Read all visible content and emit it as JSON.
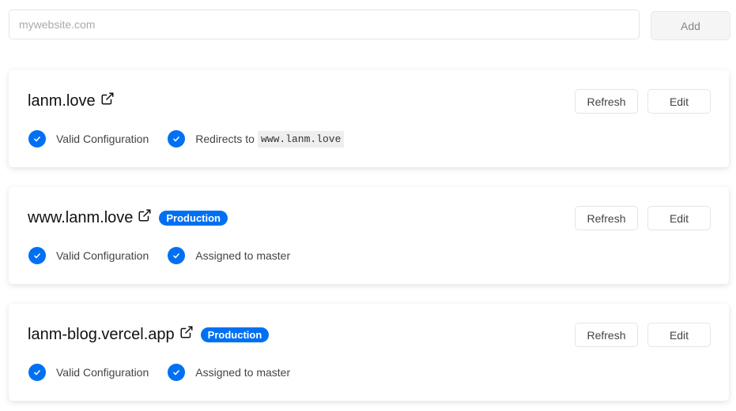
{
  "search": {
    "placeholder": "mywebsite.com",
    "add_label": "Add"
  },
  "domains": [
    {
      "name": "lanm.love",
      "badge": null,
      "status": "Valid Configuration",
      "detail": "Redirects to",
      "detail_code": "www.lanm.love",
      "refresh": "Refresh",
      "edit": "Edit"
    },
    {
      "name": "www.lanm.love",
      "badge": "Production",
      "status": "Valid Configuration",
      "detail": "Assigned to master",
      "detail_code": null,
      "refresh": "Refresh",
      "edit": "Edit"
    },
    {
      "name": "lanm-blog.vercel.app",
      "badge": "Production",
      "status": "Valid Configuration",
      "detail": "Assigned to master",
      "detail_code": null,
      "refresh": "Refresh",
      "edit": "Edit"
    }
  ]
}
